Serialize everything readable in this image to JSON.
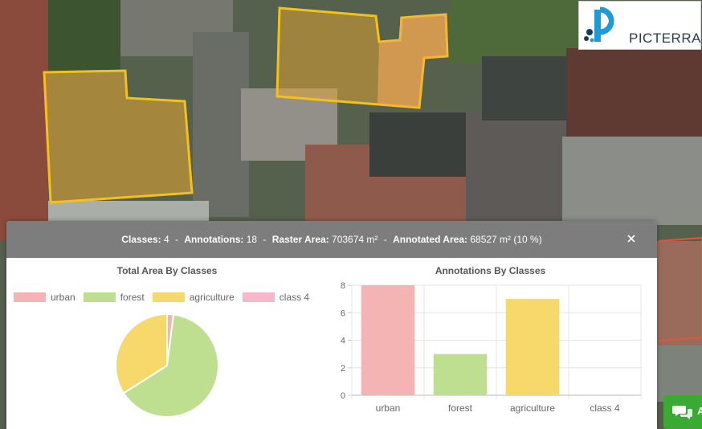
{
  "brand": {
    "name": "PICTERRA",
    "accent": "#1e9ad6",
    "accent_dark": "#173a5e"
  },
  "summary": {
    "classes_label": "Classes:",
    "classes_value": "4",
    "annotations_label": "Annotations:",
    "annotations_value": "18",
    "raster_area_label": "Raster Area:",
    "raster_area_value": "703674 m²",
    "annotated_area_label": "Annotated Area:",
    "annotated_area_value": "68527 m² (10 %)",
    "separator": "-"
  },
  "close_icon": "close-icon",
  "chat_icon": "chat-icon",
  "chat_label": "A",
  "pie_chart": {
    "title": "Total Area By Classes",
    "legend": [
      {
        "label": "urban",
        "color": "#f4b4b3"
      },
      {
        "label": "forest",
        "color": "#bedf8f"
      },
      {
        "label": "agriculture",
        "color": "#f7d86a"
      },
      {
        "label": "class 4",
        "color": "#f7b8cb"
      }
    ]
  },
  "bar_chart": {
    "title": "Annotations By Classes"
  },
  "chart_data": [
    {
      "type": "pie",
      "title": "Total Area By Classes",
      "categories": [
        "urban",
        "forest",
        "agriculture",
        "class 4"
      ],
      "values": [
        2,
        64,
        34,
        0
      ],
      "colors": [
        "#f4b4b3",
        "#bedf8f",
        "#f7d86a",
        "#f7b8cb"
      ],
      "legend_placement": "top"
    },
    {
      "type": "bar",
      "title": "Annotations By Classes",
      "categories": [
        "urban",
        "forest",
        "agriculture",
        "class 4"
      ],
      "values": [
        8,
        3,
        7,
        0
      ],
      "colors": [
        "#f4b4b3",
        "#bedf8f",
        "#f7d86a",
        "#f7b8cb"
      ],
      "yticks": [
        "0",
        "2",
        "4",
        "6",
        "8"
      ],
      "ylim": [
        0,
        8
      ],
      "grid": true
    }
  ]
}
